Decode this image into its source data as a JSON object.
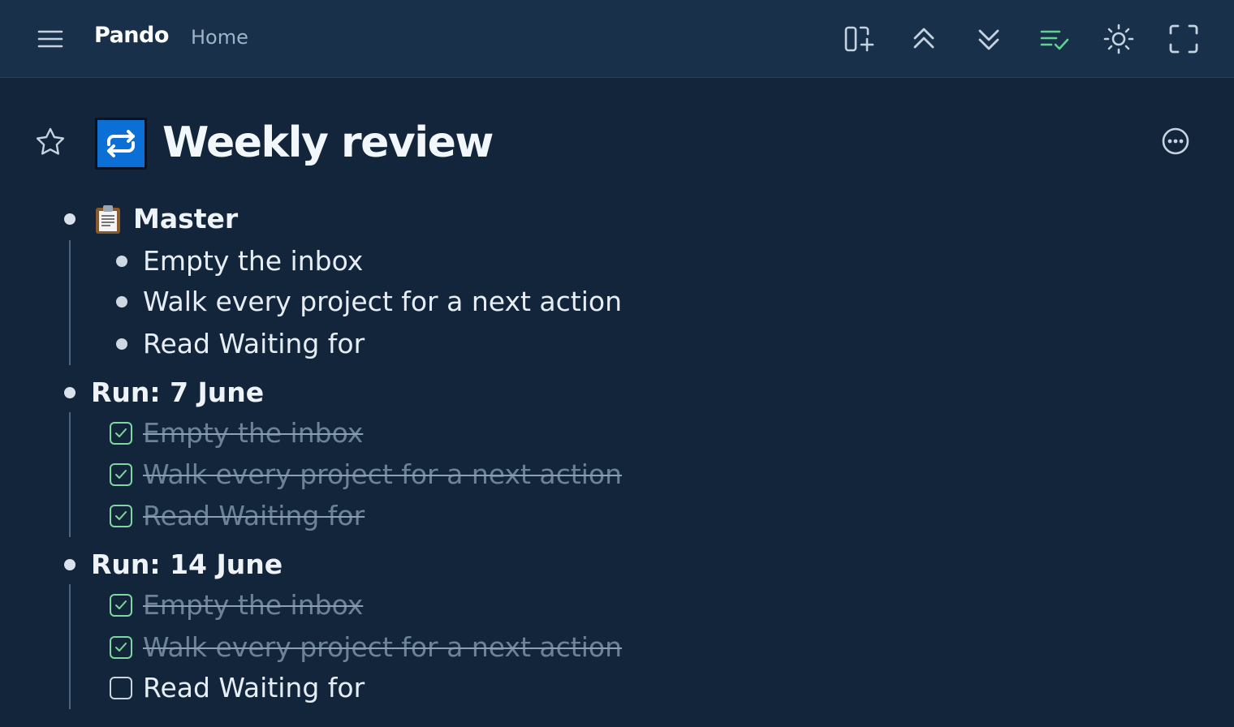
{
  "app": {
    "brand": "Pando",
    "breadcrumb": "Home"
  },
  "toolbar": {
    "icons": [
      "menu-icon",
      "add-panel-icon",
      "collapse-all-icon",
      "expand-all-icon",
      "checklist-icon",
      "brightness-icon",
      "fullscreen-icon"
    ],
    "active_color": "#5fd38f"
  },
  "page": {
    "title": "Weekly review",
    "icon": "repeat-icon",
    "icon_bg": "#0b6fd6"
  },
  "outline": {
    "master": {
      "heading": "Master",
      "emoji_icon": "clipboard-icon",
      "items": [
        "Empty the inbox",
        "Walk every project for a next action",
        "Read Waiting for"
      ]
    },
    "run1": {
      "heading": "Run: 7 June",
      "items": [
        {
          "label": "Empty the inbox",
          "done": true
        },
        {
          "label": "Walk every project for a next action",
          "done": true
        },
        {
          "label": "Read Waiting for",
          "done": true
        }
      ]
    },
    "run2": {
      "heading": "Run: 14 June",
      "items": [
        {
          "label": "Empty the inbox",
          "done": true
        },
        {
          "label": "Walk every project for a next action",
          "done": true
        },
        {
          "label": "Read Waiting for",
          "done": false
        }
      ]
    }
  }
}
